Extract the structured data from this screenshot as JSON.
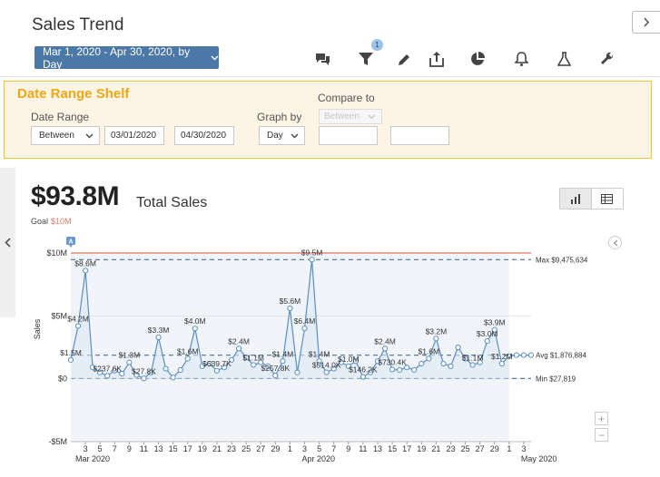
{
  "page": {
    "title": "Sales Trend"
  },
  "date_button": {
    "label": "Mar 1, 2020 - Apr 30, 2020, by Day"
  },
  "toolbar": {
    "icons": [
      "comment-icon",
      "filter-icon",
      "pencil-icon",
      "share-icon",
      "pie-chart-icon",
      "bell-icon",
      "flask-icon",
      "wrench-icon"
    ],
    "filter_badge": "1"
  },
  "shelf": {
    "title": "Date Range Shelf",
    "date_range_label": "Date Range",
    "range_mode": "Between",
    "start_date": "03/01/2020",
    "end_date": "04/30/2020",
    "graph_by_label": "Graph by",
    "graph_by_value": "Day",
    "compare_label": "Compare to",
    "compare_mode": "Between",
    "compare_start": "",
    "compare_end": ""
  },
  "kpi": {
    "value": "$93.8M",
    "label": "Total Sales",
    "goal_label": "Goal",
    "goal_value": "$10M"
  },
  "colors": {
    "accent": "#4b78a6",
    "shelf_border": "#f2c32b",
    "shelf_title": "#f0a716",
    "goal_line": "#e58b7a",
    "series_line": "#5b8fc0"
  },
  "chart_data": {
    "type": "line",
    "ylabel": "Sales",
    "xlabel": "",
    "ylim": [
      -5000000,
      10000000
    ],
    "y_ticks": [
      {
        "value": 10000000,
        "label": "$10M"
      },
      {
        "value": 5000000,
        "label": "$5M"
      },
      {
        "value": 0,
        "label": "$0"
      },
      {
        "value": -5000000,
        "label": "-$5M"
      }
    ],
    "x_ticks": [
      "3",
      "5",
      "7",
      "9",
      "11",
      "13",
      "15",
      "17",
      "19",
      "21",
      "23",
      "25",
      "27",
      "29",
      "1",
      "3",
      "5",
      "7",
      "9",
      "11",
      "13",
      "15",
      "17",
      "19",
      "21",
      "23",
      "25",
      "27",
      "29",
      "1",
      "3"
    ],
    "month_labels": [
      "Mar 2020",
      "Apr 2020",
      "May 2020"
    ],
    "series": [
      {
        "values": [
          1500000,
          4200000,
          8600000,
          900000,
          500000,
          237600,
          650000,
          400000,
          1300000,
          300000,
          27819,
          500000,
          3300000,
          800000,
          100000,
          700000,
          1600000,
          4000000,
          1000000,
          1200000,
          639700,
          900000,
          1500000,
          2400000,
          1700000,
          1100000,
          1300000,
          1000000,
          257800,
          1400000,
          5600000,
          500000,
          4000000,
          9475634,
          1400000,
          514000,
          800000,
          1300000,
          1000000,
          1400000,
          146200,
          500000,
          1400000,
          2400000,
          730400,
          700000,
          900000,
          700000,
          1200000,
          1600000,
          3200000,
          1200000,
          1000000,
          2500000,
          1600000,
          1100000,
          1300000,
          3000000,
          3900000,
          1200000,
          1800000
        ],
        "point_labels": [
          {
            "index": 0,
            "text": "$1.5M"
          },
          {
            "index": 1,
            "text": "$4.2M"
          },
          {
            "index": 2,
            "text": "$8.6M"
          },
          {
            "index": 5,
            "text": "$237.6K"
          },
          {
            "index": 8,
            "text": "$1.3M"
          },
          {
            "index": 10,
            "text": "$27.8K"
          },
          {
            "index": 12,
            "text": "$3.3M"
          },
          {
            "index": 16,
            "text": "$1.6M"
          },
          {
            "index": 17,
            "text": "$4.0M"
          },
          {
            "index": 20,
            "text": "$639.7K"
          },
          {
            "index": 23,
            "text": "$2.4M"
          },
          {
            "index": 25,
            "text": "$1.1M"
          },
          {
            "index": 28,
            "text": "$257.8K"
          },
          {
            "index": 29,
            "text": "$1.4M"
          },
          {
            "index": 30,
            "text": "$5.6M"
          },
          {
            "index": 32,
            "text": "$6.4M"
          },
          {
            "index": 33,
            "text": "$9.5M"
          },
          {
            "index": 34,
            "text": "$1.4M"
          },
          {
            "index": 35,
            "text": "$514.0K"
          },
          {
            "index": 38,
            "text": "$1.0M"
          },
          {
            "index": 40,
            "text": "$146.2K"
          },
          {
            "index": 43,
            "text": "$2.4M"
          },
          {
            "index": 44,
            "text": "$730.4K"
          },
          {
            "index": 49,
            "text": "$1.6M"
          },
          {
            "index": 50,
            "text": "$3.2M"
          },
          {
            "index": 55,
            "text": "$1.1M"
          },
          {
            "index": 57,
            "text": "$3.0M"
          },
          {
            "index": 58,
            "text": "$3.9M"
          },
          {
            "index": 59,
            "text": "$1.2M"
          }
        ]
      }
    ],
    "forecast_values": [
      1876884,
      1876884,
      1876884
    ],
    "reference_lines": [
      {
        "value": 10000000,
        "label": "",
        "kind": "goal"
      },
      {
        "value": 9475634,
        "label": "Max $9,475,634",
        "kind": "max"
      },
      {
        "value": 1876884,
        "label": "Avg $1,876,884",
        "kind": "avg"
      },
      {
        "value": 27819,
        "label": "Min $27,819",
        "kind": "min"
      }
    ],
    "annotation_flag": "A",
    "grid": true
  }
}
